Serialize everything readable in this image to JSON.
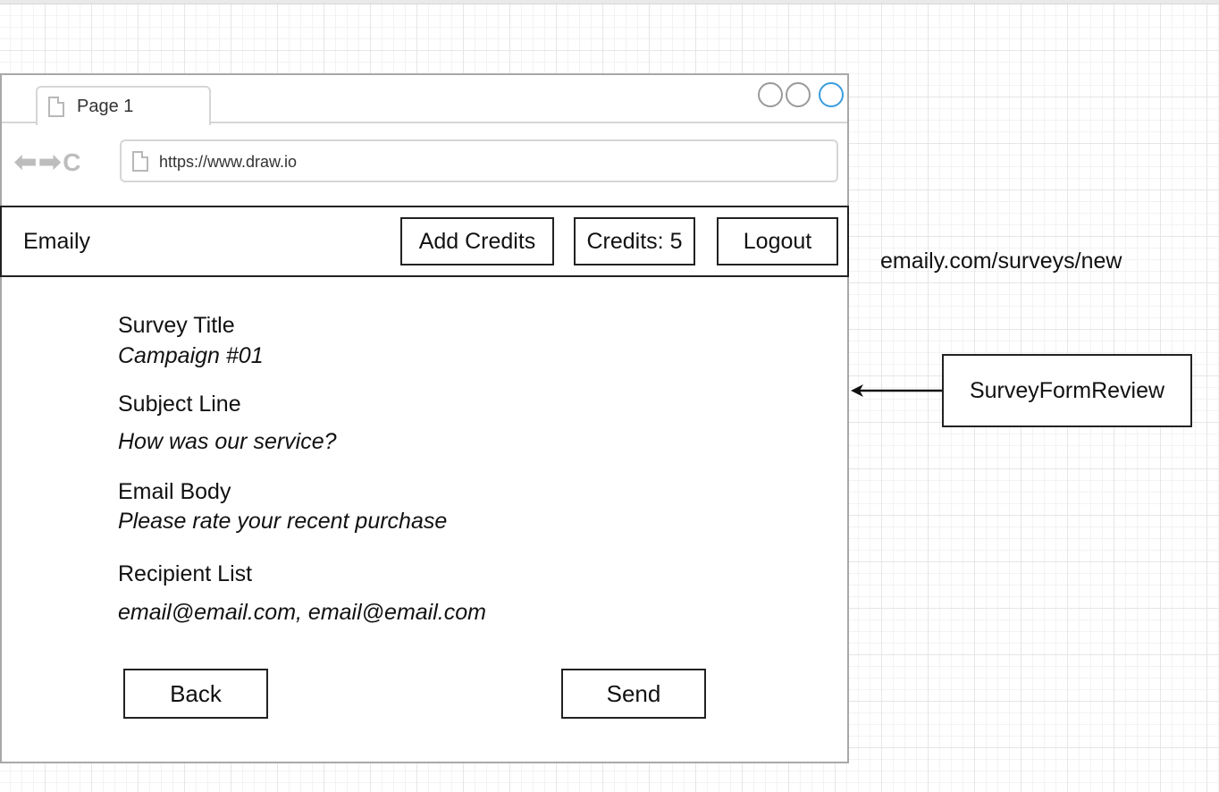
{
  "browser": {
    "tab_label": "Page 1",
    "url": "https://www.draw.io",
    "icons": [
      "back-arrow-icon",
      "forward-arrow-icon",
      "refresh-icon",
      "page-icon"
    ]
  },
  "navbar": {
    "brand": "Emaily",
    "add_credits_label": "Add Credits",
    "credits_label": "Credits: 5",
    "logout_label": "Logout"
  },
  "review": {
    "fields": [
      {
        "label": "Survey Title",
        "value": "Campaign #01"
      },
      {
        "label": "Subject Line",
        "value": "How was our service?"
      },
      {
        "label": "Email Body",
        "value": "Please rate your recent purchase"
      },
      {
        "label": "Recipient List",
        "value": "email@email.com, email@email.com"
      }
    ],
    "back_label": "Back",
    "send_label": "Send"
  },
  "annotations": {
    "route": "emaily.com/surveys/new",
    "component": "SurveyFormReview"
  },
  "colors": {
    "window_button_active": "#3a9de0",
    "border": "#222222",
    "browser_chrome": "#d6d6d6"
  }
}
